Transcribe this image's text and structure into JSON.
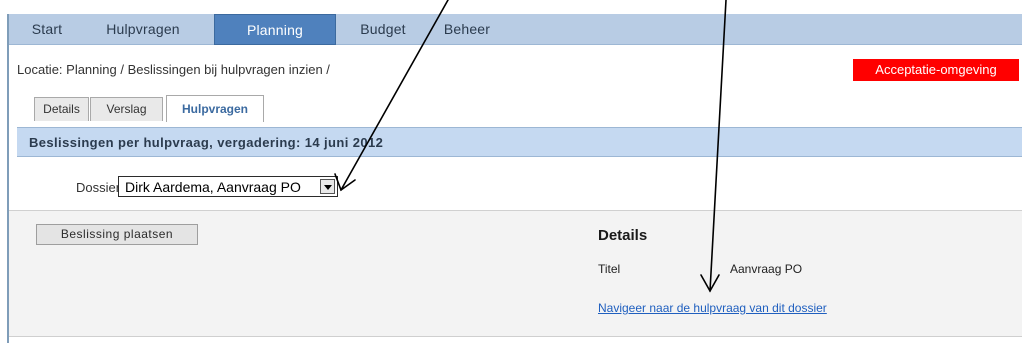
{
  "nav": {
    "tabs": [
      "Start",
      "Hulpvragen",
      "Planning",
      "Budget",
      "Beheer"
    ],
    "active": "Planning"
  },
  "breadcrumb": "Locatie: Planning / Beslissingen bij hulpvragen inzien /",
  "environment_badge": "Acceptatie-omgeving",
  "subtabs": [
    "Details",
    "Verslag",
    "Hulpvragen"
  ],
  "active_subtab": "Hulpvragen",
  "section_title": "Beslissingen per hulpvraag, vergadering: 14 juni 2012",
  "dossier": {
    "label": "Dossier",
    "selected": "Dirk Aardema, Aanvraag PO"
  },
  "actions": {
    "place_decision": "Beslissing plaatsen"
  },
  "details": {
    "heading": "Details",
    "titel_label": "Titel",
    "titel_value": "Aanvraag PO",
    "link": "Navigeer naar de hulpvraag van dit dossier"
  },
  "colors": {
    "nav_bg": "#b8cce4",
    "nav_active": "#4f81bd",
    "badge": "#ff0000",
    "section_header": "#c5d9f1",
    "link": "#1f5fbf"
  }
}
